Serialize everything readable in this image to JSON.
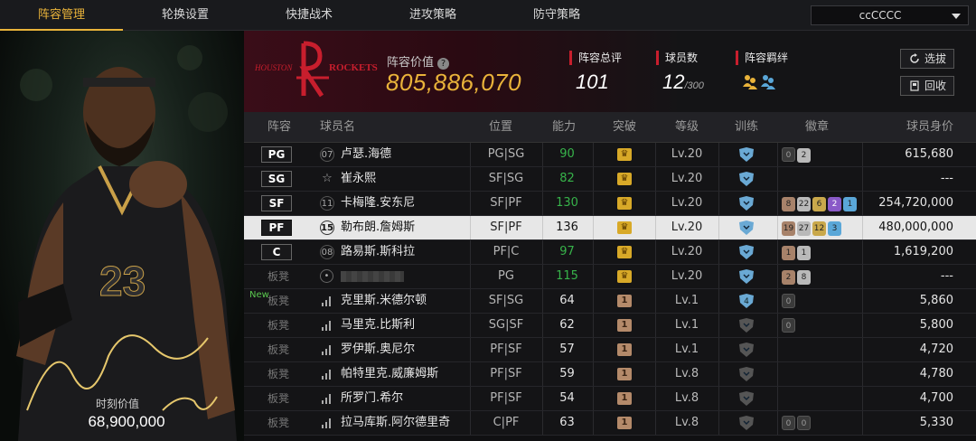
{
  "nav": {
    "tabs": [
      "阵容管理",
      "轮换设置",
      "快捷战术",
      "进攻策略",
      "防守策略"
    ],
    "active_index": 0,
    "team_select": "ccCCCC"
  },
  "player_card": {
    "jersey_number": "23",
    "moment_label": "时刻价值",
    "moment_value": "68,900,000"
  },
  "header": {
    "logo_text": "HOUSTON ROCKETS",
    "lineup_value_label": "阵容价值",
    "lineup_value": "805,886,070",
    "rating_label": "阵容总评",
    "rating_value": "101",
    "count_label": "球员数",
    "count_value": "12",
    "count_max": "/300",
    "bond_label": "阵容羁绊",
    "btn_pick": "选拔",
    "btn_recycle": "回收"
  },
  "table": {
    "headers": [
      "阵容",
      "球员名",
      "位置",
      "能力",
      "突破",
      "等级",
      "训练",
      "徽章",
      "球员身价"
    ],
    "rows": [
      {
        "slot": "PG",
        "num": "07",
        "name": "卢瑟.海德",
        "pos": "PG|SG",
        "ability": "90",
        "green": true,
        "break": "gold",
        "level": "Lv.20",
        "train": "blue",
        "badges": [
          {
            "t": "dk",
            "v": "0"
          },
          {
            "t": "sv",
            "v": "2"
          }
        ],
        "value": "615,680"
      },
      {
        "slot": "SG",
        "num": "☆",
        "name": "崔永熙",
        "pos": "SF|SG",
        "ability": "82",
        "green": true,
        "break": "gold",
        "level": "Lv.20",
        "train": "blue",
        "badges": [],
        "value": "---"
      },
      {
        "slot": "SF",
        "num": "11",
        "name": "卡梅隆.安东尼",
        "pos": "SF|PF",
        "ability": "130",
        "green": true,
        "break": "gold",
        "level": "Lv.20",
        "train": "blue",
        "badges": [
          {
            "t": "br",
            "v": "8"
          },
          {
            "t": "sv",
            "v": "22"
          },
          {
            "t": "gd",
            "v": "6"
          },
          {
            "t": "pu",
            "v": "2"
          },
          {
            "t": "bl",
            "v": "1"
          }
        ],
        "value": "254,720,000"
      },
      {
        "slot": "PF",
        "num": "15",
        "name": "勒布朗.詹姆斯",
        "pos": "SF|PF",
        "ability": "136",
        "green": false,
        "break": "gold",
        "level": "Lv.20",
        "train": "blue",
        "badges": [
          {
            "t": "br",
            "v": "19"
          },
          {
            "t": "sv",
            "v": "27"
          },
          {
            "t": "gd",
            "v": "12"
          },
          {
            "t": "bl",
            "v": "3"
          }
        ],
        "value": "480,000,000",
        "selected": true
      },
      {
        "slot": "C",
        "num": "08",
        "name": "路易斯.斯科拉",
        "pos": "PF|C",
        "ability": "97",
        "green": true,
        "break": "gold",
        "level": "Lv.20",
        "train": "blue",
        "badges": [
          {
            "t": "br",
            "v": "1"
          },
          {
            "t": "sv",
            "v": "1"
          }
        ],
        "value": "1,619,200"
      },
      {
        "slot": "板凳",
        "num": "👤",
        "name": "",
        "pos": "PG",
        "ability": "115",
        "green": true,
        "break": "gold",
        "level": "Lv.20",
        "train": "blue",
        "badges": [
          {
            "t": "br",
            "v": "2"
          },
          {
            "t": "sv",
            "v": "8"
          }
        ],
        "value": "---"
      },
      {
        "slot": "板凳",
        "new": "New",
        "num": "▮",
        "name": "克里斯.米德尔顿",
        "pos": "SF|SG",
        "ability": "64",
        "green": false,
        "break": "one",
        "level": "Lv.1",
        "train": "blue4",
        "badges": [
          {
            "t": "dk",
            "v": "0"
          }
        ],
        "value": "5,860"
      },
      {
        "slot": "板凳",
        "num": "▮",
        "name": "马里克.比斯利",
        "pos": "SG|SF",
        "ability": "62",
        "green": false,
        "break": "one",
        "level": "Lv.1",
        "train": "grey",
        "badges": [
          {
            "t": "dk",
            "v": "0"
          }
        ],
        "value": "5,800"
      },
      {
        "slot": "板凳",
        "num": "▮",
        "name": "罗伊斯.奥尼尔",
        "pos": "PF|SF",
        "ability": "57",
        "green": false,
        "break": "one",
        "level": "Lv.1",
        "train": "grey",
        "badges": [],
        "value": "4,720"
      },
      {
        "slot": "板凳",
        "num": "▮",
        "name": "帕特里克.威廉姆斯",
        "pos": "PF|SF",
        "ability": "59",
        "green": false,
        "break": "one",
        "level": "Lv.8",
        "train": "grey",
        "badges": [],
        "value": "4,780"
      },
      {
        "slot": "板凳",
        "num": "▮",
        "name": "所罗门.希尔",
        "pos": "PF|SF",
        "ability": "54",
        "green": false,
        "break": "one",
        "level": "Lv.8",
        "train": "grey",
        "badges": [],
        "value": "4,700"
      },
      {
        "slot": "板凳",
        "num": "▮",
        "name": "拉马库斯.阿尔德里奇",
        "pos": "C|PF",
        "ability": "63",
        "green": false,
        "break": "one",
        "level": "Lv.8",
        "train": "grey",
        "badges": [
          {
            "t": "dk",
            "v": "0"
          },
          {
            "t": "dk",
            "v": "0"
          }
        ],
        "value": "5,330"
      }
    ]
  },
  "colors": {
    "accent": "#e9b33a",
    "red": "#c81e2d",
    "green": "#37b34a"
  }
}
